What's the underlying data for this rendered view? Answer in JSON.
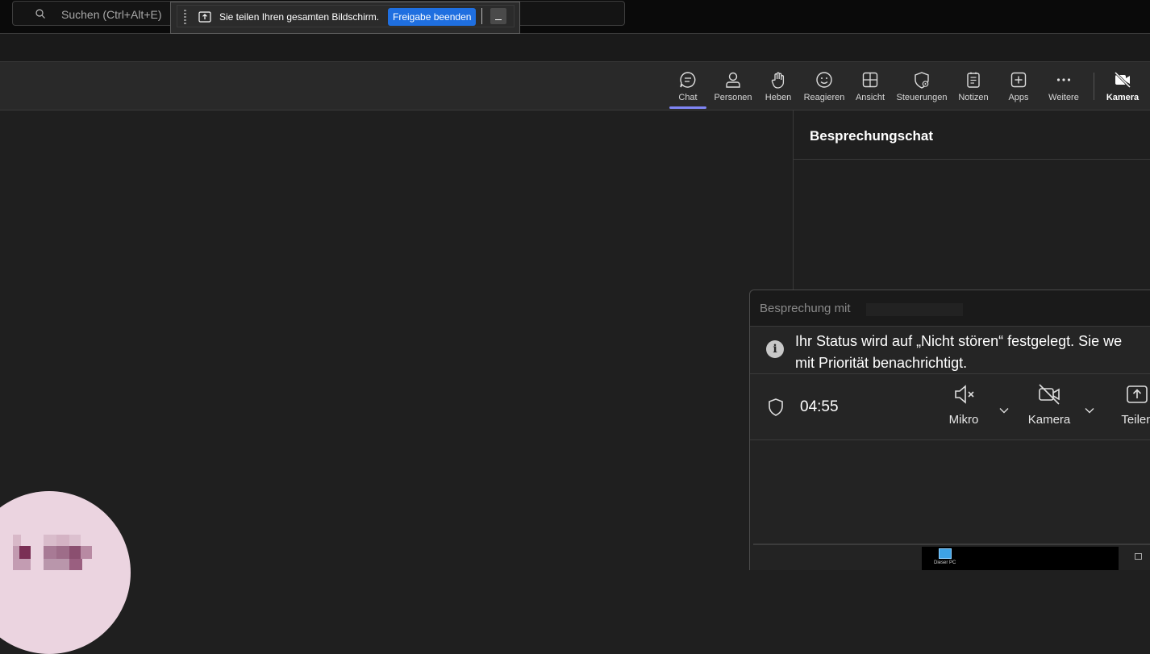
{
  "search": {
    "placeholder": "Suchen (Ctrl+Alt+E)"
  },
  "sharing_bar": {
    "message": "Sie teilen Ihren gesamten Bildschirm.",
    "stop_label": "Freigabe beenden"
  },
  "toolbar": {
    "buttons": [
      {
        "label": "Chat",
        "icon": "chat-icon",
        "active": true
      },
      {
        "label": "Personen",
        "icon": "people-icon"
      },
      {
        "label": "Heben",
        "icon": "raise-hand-icon"
      },
      {
        "label": "Reagieren",
        "icon": "react-icon"
      },
      {
        "label": "Ansicht",
        "icon": "view-icon"
      },
      {
        "label": "Steuerungen",
        "icon": "controls-icon"
      },
      {
        "label": "Notizen",
        "icon": "notes-icon"
      },
      {
        "label": "Apps",
        "icon": "apps-icon"
      },
      {
        "label": "Weitere",
        "icon": "more-icon"
      },
      {
        "label": "Kamera",
        "icon": "camera-off-icon"
      }
    ],
    "accent": "#7f85f5"
  },
  "chat_panel": {
    "title": "Besprechungschat"
  },
  "mini_window": {
    "title": "Besprechung mit",
    "info_line1": "Ihr Status wird auf „Nicht stören“ festgelegt. Sie we",
    "info_line2": "mit Priorität benachrichtigt.",
    "timer": "04:55",
    "controls": [
      {
        "label": "Mikro",
        "icon": "mic-muted-icon"
      },
      {
        "label": "Kamera",
        "icon": "camera-off-icon"
      },
      {
        "label": "Teilen",
        "icon": "share-icon"
      }
    ]
  },
  "taskbar": {
    "pc_label": "Dieser PC"
  }
}
